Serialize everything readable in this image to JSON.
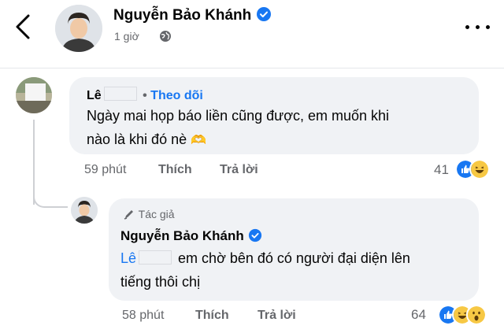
{
  "post": {
    "author_name": "Nguyễn Bảo Khánh",
    "time": "1 giờ"
  },
  "comment1": {
    "author_prefix": "Lê",
    "follow_label": "Theo dõi",
    "text_line1": "Ngày mai họp báo liền cũng được, em muốn khi",
    "text_line2": "nào là khi đó nè",
    "emoji": "🫶",
    "time": "59 phút",
    "like_label": "Thích",
    "reply_label": "Trả lời",
    "reaction_count": "41"
  },
  "reply1": {
    "badge_label": "Tác giả",
    "author_name": "Nguyễn Bảo Khánh",
    "mention": "Lê",
    "text_line1": "em chờ bên đó có người đại diện lên",
    "text_line2": "tiếng thôi chị",
    "time": "58 phút",
    "like_label": "Thích",
    "reply_label": "Trả lời",
    "reaction_count": "64"
  },
  "icons": {
    "back": "chevron-left-icon",
    "verified": "verified-badge-icon",
    "globe": "globe-icon",
    "more": "more-horizontal-icon",
    "author_badge": "pen-icon"
  },
  "colors": {
    "link_blue": "#1877f2",
    "verified_blue": "#1877f2",
    "bubble_bg": "#f0f2f5",
    "secondary_text": "#65676b"
  }
}
